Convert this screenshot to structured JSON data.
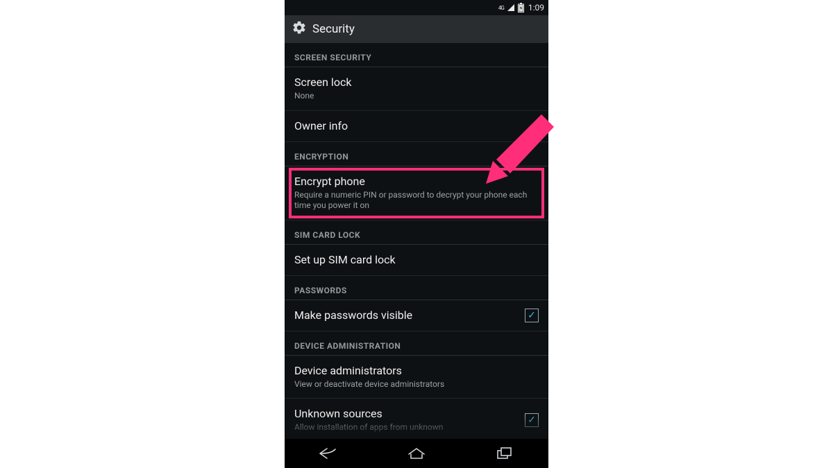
{
  "statusbar": {
    "network_label": "4G",
    "time": "1:09"
  },
  "titlebar": {
    "title": "Security"
  },
  "sections": {
    "screen_security": {
      "header": "SCREEN SECURITY",
      "items": {
        "screen_lock": {
          "label": "Screen lock",
          "sub": "None"
        },
        "owner_info": {
          "label": "Owner info"
        }
      }
    },
    "encryption": {
      "header": "ENCRYPTION",
      "items": {
        "encrypt_phone": {
          "label": "Encrypt phone",
          "sub": "Require a numeric PIN or password to decrypt your phone each time you power it on"
        }
      }
    },
    "sim_card_lock": {
      "header": "SIM CARD LOCK",
      "items": {
        "setup_sim_lock": {
          "label": "Set up SIM card lock"
        }
      }
    },
    "passwords": {
      "header": "PASSWORDS",
      "items": {
        "make_pw_visible": {
          "label": "Make passwords visible",
          "checked": true
        }
      }
    },
    "device_admin": {
      "header": "DEVICE ADMINISTRATION",
      "items": {
        "device_admins": {
          "label": "Device administrators",
          "sub": "View or deactivate device administrators"
        },
        "unknown_sources": {
          "label": "Unknown sources",
          "sub": "Allow installation of apps from unknown",
          "checked": true
        }
      }
    }
  },
  "annotation": {
    "arrow_color": "#ff2d7a",
    "highlight_color": "#ff2d7a"
  }
}
